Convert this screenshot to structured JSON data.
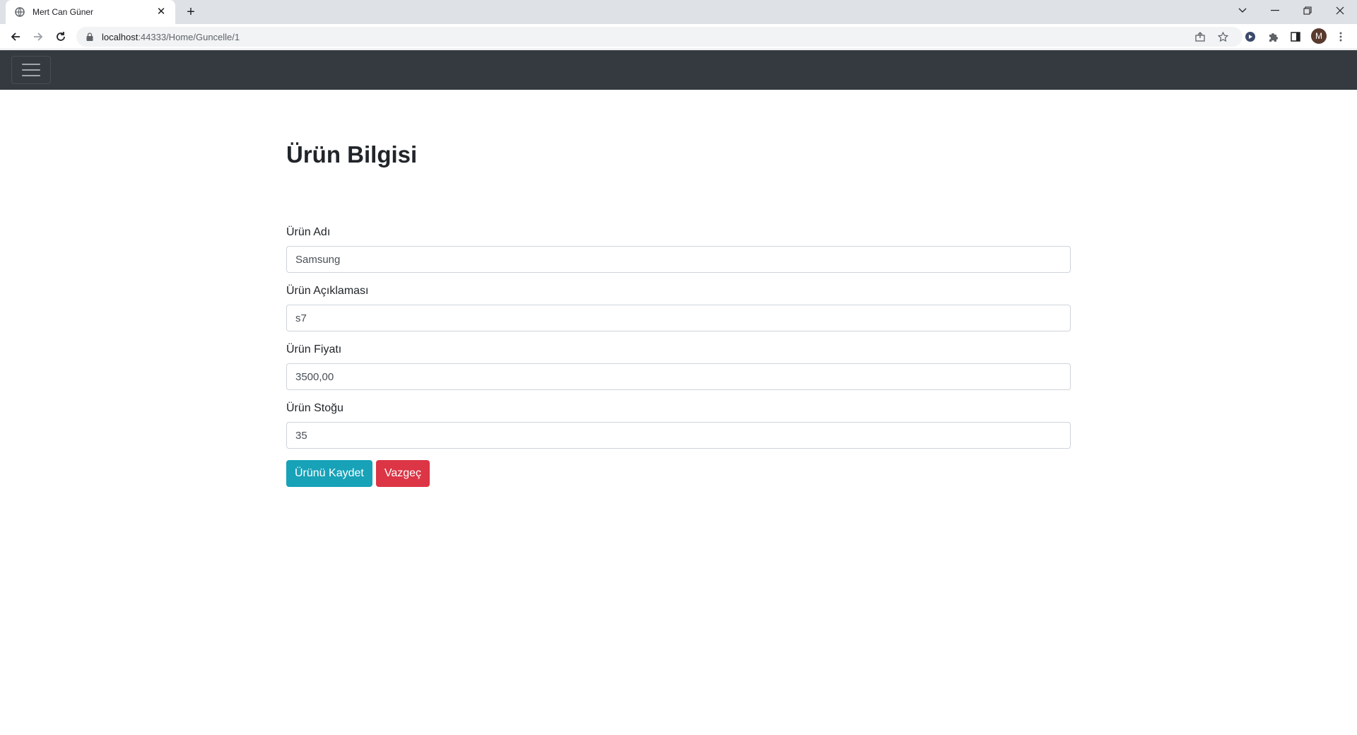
{
  "browser": {
    "tab_title": "Mert Can Güner",
    "new_tab": "+",
    "close_tab": "✕",
    "url_host": "localhost",
    "url_path": ":44333/Home/Guncelle/1",
    "profile_initial": "M"
  },
  "page": {
    "heading": "Ürün Bilgisi"
  },
  "form": {
    "fields": [
      {
        "label": "Ürün Adı",
        "value": "Samsung"
      },
      {
        "label": "Ürün Açıklaması",
        "value": "s7"
      },
      {
        "label": "Ürün Fiyatı",
        "value": "3500,00"
      },
      {
        "label": "Ürün Stoğu",
        "value": "35"
      }
    ],
    "save_label": "Ürünü Kaydet",
    "cancel_label": "Vazgeç"
  },
  "colors": {
    "navbar": "#343a40",
    "save_button": "#17a2b8",
    "cancel_button": "#dc3545"
  },
  "icons": [
    "globe-icon",
    "close-icon",
    "plus-icon",
    "back-icon",
    "forward-icon",
    "reload-icon",
    "lock-icon",
    "share-icon",
    "star-icon",
    "extension-icon",
    "puzzle-icon",
    "sidepanel-icon",
    "menu-icon",
    "hamburger-icon"
  ]
}
